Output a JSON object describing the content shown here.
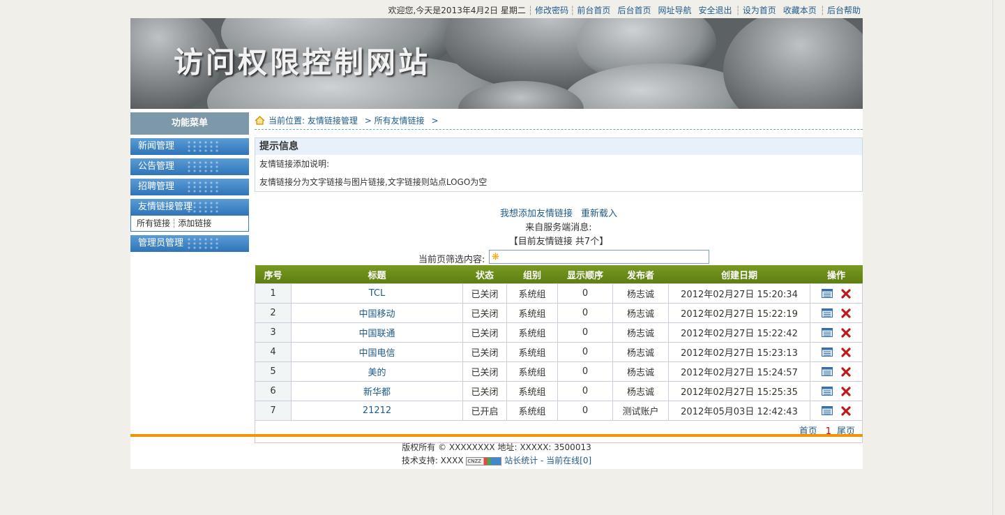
{
  "topbar": {
    "welcome": "欢迎您,今天是2013年4月2日 星期二",
    "links": [
      "修改密码",
      "前台首页",
      "后台首页",
      "网址导航",
      "安全退出",
      "设为首页",
      "收藏本页",
      "后台帮助"
    ]
  },
  "banner": {
    "title": "访问权限控制网站"
  },
  "sidebar": {
    "heading": "功能菜单",
    "items": [
      "新闻管理",
      "公告管理",
      "招聘管理",
      "友情链接管理",
      "管理员管理"
    ],
    "submenu": [
      "所有链接",
      "添加链接"
    ]
  },
  "breadcrumb": {
    "prefix": "当前位置:",
    "level1": "友情链接管理",
    "sep": ">",
    "level2": "所有友情链接",
    "end": ">"
  },
  "hint": {
    "title": "提示信息",
    "line1": "友情链接添加说明:",
    "line2": "友情链接分为文字链接与图片链接,文字链接则站点LOGO为空"
  },
  "actions": {
    "add": "我想添加友情链接",
    "reload": "重新载入",
    "server_msg": "来自服务端消息:",
    "count": "【目前友情链接 共7个】"
  },
  "filter": {
    "label": "当前页筛选内容:",
    "value": ""
  },
  "table": {
    "headers": [
      "序号",
      "标题",
      "状态",
      "组别",
      "显示顺序",
      "发布者",
      "创建日期",
      "操作"
    ],
    "rows": [
      [
        "1",
        "TCL",
        "已关闭",
        "系统组",
        "0",
        "杨志诚",
        "2012年02月27日  15:20:34"
      ],
      [
        "2",
        "中国移动",
        "已关闭",
        "系统组",
        "0",
        "杨志诚",
        "2012年02月27日  15:22:19"
      ],
      [
        "3",
        "中国联通",
        "已关闭",
        "系统组",
        "0",
        "杨志诚",
        "2012年02月27日  15:22:42"
      ],
      [
        "4",
        "中国电信",
        "已关闭",
        "系统组",
        "0",
        "杨志诚",
        "2012年02月27日  15:23:13"
      ],
      [
        "5",
        "美的",
        "已关闭",
        "系统组",
        "0",
        "杨志诚",
        "2012年02月27日  15:24:57"
      ],
      [
        "6",
        "新华都",
        "已关闭",
        "系统组",
        "0",
        "杨志诚",
        "2012年02月27日  15:25:35"
      ],
      [
        "7",
        "21212",
        "已开启",
        "系统组",
        "0",
        "测试账户",
        "2012年05月03日  12:42:43"
      ]
    ]
  },
  "pager": {
    "first": "首页",
    "current": "1",
    "last": "尾页"
  },
  "footer": {
    "copyright": "版权所有 © XXXXXXXX 地址: XXXXX: 3500013",
    "support": "技术支持: XXXX",
    "cnzz": "CNZZ",
    "stats": "站长统计 - 当前在线[0]"
  },
  "colors": {
    "accent": "#f39500",
    "table_header": "#6b8b1a",
    "menu": "#3a80c3"
  }
}
